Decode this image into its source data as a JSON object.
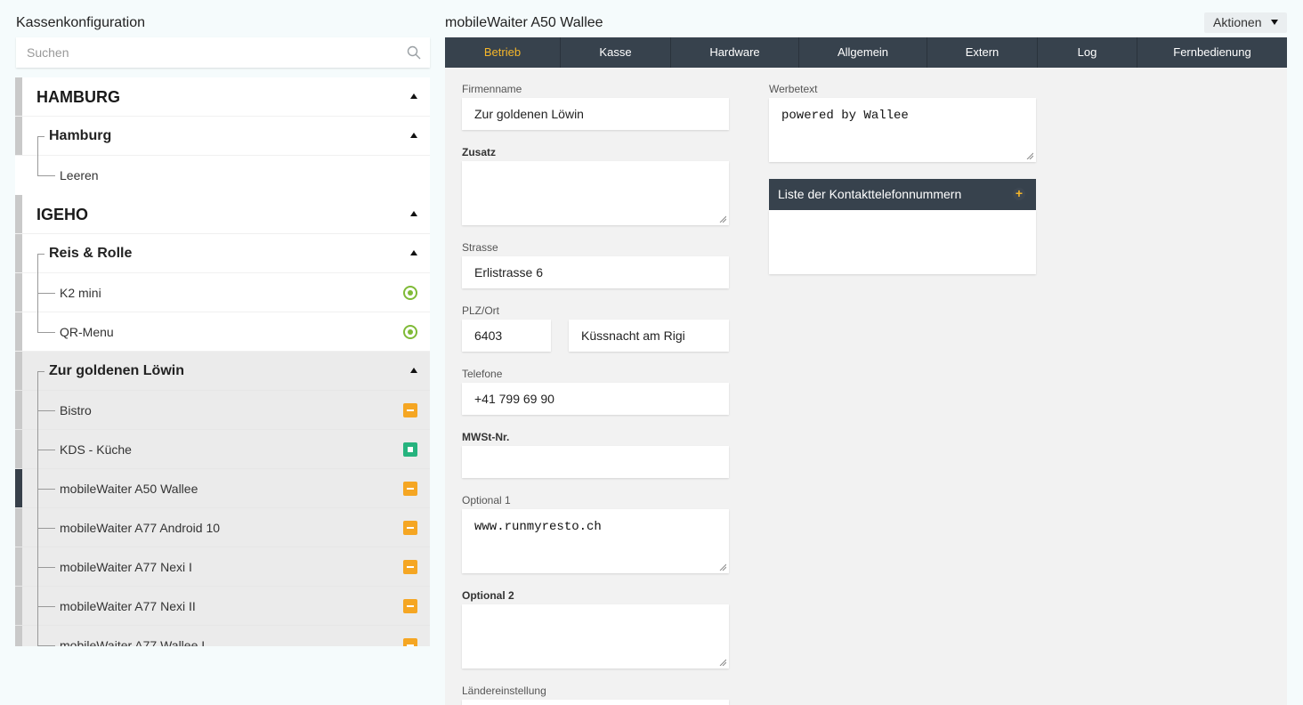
{
  "left": {
    "title": "Kassenkonfiguration",
    "search_placeholder": "Suchen",
    "tree": {
      "hamburg_group": "HAMBURG",
      "hamburg_site": "Hamburg",
      "leeren": "Leeren",
      "igeho_group": "IGEHO",
      "reis_site": "Reis & Rolle",
      "k2mini": "K2 mini",
      "qrmenu": "QR-Menu",
      "loewin_site": "Zur goldenen Löwin",
      "bistro": "Bistro",
      "kds": "KDS - Küche",
      "mw_a50": "mobileWaiter A50 Wallee",
      "mw_a77_android": "mobileWaiter A77 Android 10",
      "mw_a77_nexi1": "mobileWaiter A77 Nexi I",
      "mw_a77_nexi2": "mobileWaiter A77 Nexi II",
      "mw_a77_wallee1": "mobileWaiter A77 Wallee I"
    }
  },
  "right": {
    "title": "mobileWaiter A50 Wallee",
    "actions_label": "Aktionen",
    "tabs": [
      "Betrieb",
      "Kasse",
      "Hardware",
      "Allgemein",
      "Extern",
      "Log",
      "Fernbedienung"
    ],
    "form": {
      "firmenname_label": "Firmenname",
      "firmenname_value": "Zur goldenen Löwin",
      "zusatz_label": "Zusatz",
      "zusatz_value": "",
      "strasse_label": "Strasse",
      "strasse_value": "Erlistrasse 6",
      "plzort_label": "PLZ/Ort",
      "plz_value": "6403",
      "ort_value": "Küssnacht am Rigi",
      "telefone_label": "Telefone",
      "telefone_value": "+41 799 69 90",
      "mwst_label": "MWSt-Nr.",
      "mwst_value": "",
      "optional1_label": "Optional 1",
      "optional1_value": "www.runmyresto.ch",
      "optional2_label": "Optional 2",
      "optional2_value": "",
      "laender_label": "Ländereinstellung",
      "werbetext_label": "Werbetext",
      "werbetext_value": "powered by Wallee",
      "contact_list_title": "Liste der Kontakttelefonnummern"
    }
  }
}
